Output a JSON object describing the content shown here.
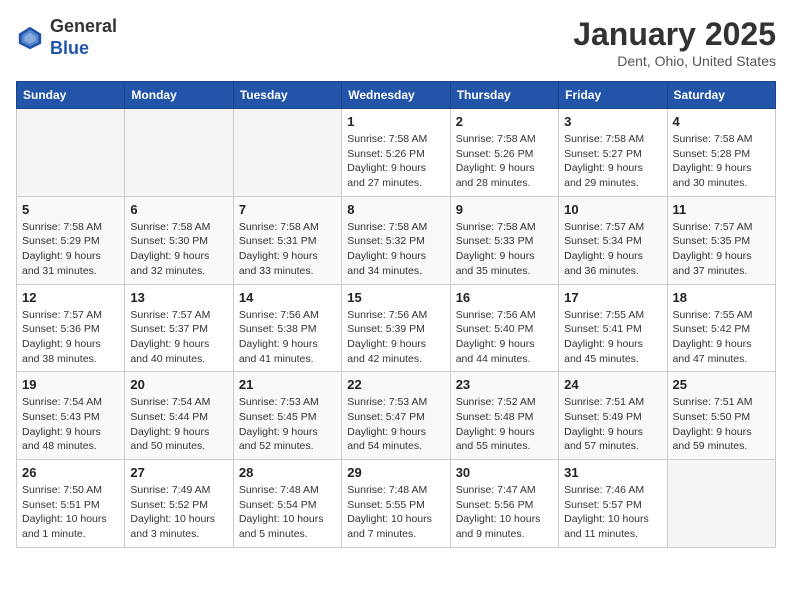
{
  "header": {
    "logo_line1": "General",
    "logo_line2": "Blue",
    "month": "January 2025",
    "location": "Dent, Ohio, United States"
  },
  "days_of_week": [
    "Sunday",
    "Monday",
    "Tuesday",
    "Wednesday",
    "Thursday",
    "Friday",
    "Saturday"
  ],
  "weeks": [
    [
      {
        "day": "",
        "info": ""
      },
      {
        "day": "",
        "info": ""
      },
      {
        "day": "",
        "info": ""
      },
      {
        "day": "1",
        "info": "Sunrise: 7:58 AM\nSunset: 5:26 PM\nDaylight: 9 hours and 27 minutes."
      },
      {
        "day": "2",
        "info": "Sunrise: 7:58 AM\nSunset: 5:26 PM\nDaylight: 9 hours and 28 minutes."
      },
      {
        "day": "3",
        "info": "Sunrise: 7:58 AM\nSunset: 5:27 PM\nDaylight: 9 hours and 29 minutes."
      },
      {
        "day": "4",
        "info": "Sunrise: 7:58 AM\nSunset: 5:28 PM\nDaylight: 9 hours and 30 minutes."
      }
    ],
    [
      {
        "day": "5",
        "info": "Sunrise: 7:58 AM\nSunset: 5:29 PM\nDaylight: 9 hours and 31 minutes."
      },
      {
        "day": "6",
        "info": "Sunrise: 7:58 AM\nSunset: 5:30 PM\nDaylight: 9 hours and 32 minutes."
      },
      {
        "day": "7",
        "info": "Sunrise: 7:58 AM\nSunset: 5:31 PM\nDaylight: 9 hours and 33 minutes."
      },
      {
        "day": "8",
        "info": "Sunrise: 7:58 AM\nSunset: 5:32 PM\nDaylight: 9 hours and 34 minutes."
      },
      {
        "day": "9",
        "info": "Sunrise: 7:58 AM\nSunset: 5:33 PM\nDaylight: 9 hours and 35 minutes."
      },
      {
        "day": "10",
        "info": "Sunrise: 7:57 AM\nSunset: 5:34 PM\nDaylight: 9 hours and 36 minutes."
      },
      {
        "day": "11",
        "info": "Sunrise: 7:57 AM\nSunset: 5:35 PM\nDaylight: 9 hours and 37 minutes."
      }
    ],
    [
      {
        "day": "12",
        "info": "Sunrise: 7:57 AM\nSunset: 5:36 PM\nDaylight: 9 hours and 38 minutes."
      },
      {
        "day": "13",
        "info": "Sunrise: 7:57 AM\nSunset: 5:37 PM\nDaylight: 9 hours and 40 minutes."
      },
      {
        "day": "14",
        "info": "Sunrise: 7:56 AM\nSunset: 5:38 PM\nDaylight: 9 hours and 41 minutes."
      },
      {
        "day": "15",
        "info": "Sunrise: 7:56 AM\nSunset: 5:39 PM\nDaylight: 9 hours and 42 minutes."
      },
      {
        "day": "16",
        "info": "Sunrise: 7:56 AM\nSunset: 5:40 PM\nDaylight: 9 hours and 44 minutes."
      },
      {
        "day": "17",
        "info": "Sunrise: 7:55 AM\nSunset: 5:41 PM\nDaylight: 9 hours and 45 minutes."
      },
      {
        "day": "18",
        "info": "Sunrise: 7:55 AM\nSunset: 5:42 PM\nDaylight: 9 hours and 47 minutes."
      }
    ],
    [
      {
        "day": "19",
        "info": "Sunrise: 7:54 AM\nSunset: 5:43 PM\nDaylight: 9 hours and 48 minutes."
      },
      {
        "day": "20",
        "info": "Sunrise: 7:54 AM\nSunset: 5:44 PM\nDaylight: 9 hours and 50 minutes."
      },
      {
        "day": "21",
        "info": "Sunrise: 7:53 AM\nSunset: 5:45 PM\nDaylight: 9 hours and 52 minutes."
      },
      {
        "day": "22",
        "info": "Sunrise: 7:53 AM\nSunset: 5:47 PM\nDaylight: 9 hours and 54 minutes."
      },
      {
        "day": "23",
        "info": "Sunrise: 7:52 AM\nSunset: 5:48 PM\nDaylight: 9 hours and 55 minutes."
      },
      {
        "day": "24",
        "info": "Sunrise: 7:51 AM\nSunset: 5:49 PM\nDaylight: 9 hours and 57 minutes."
      },
      {
        "day": "25",
        "info": "Sunrise: 7:51 AM\nSunset: 5:50 PM\nDaylight: 9 hours and 59 minutes."
      }
    ],
    [
      {
        "day": "26",
        "info": "Sunrise: 7:50 AM\nSunset: 5:51 PM\nDaylight: 10 hours and 1 minute."
      },
      {
        "day": "27",
        "info": "Sunrise: 7:49 AM\nSunset: 5:52 PM\nDaylight: 10 hours and 3 minutes."
      },
      {
        "day": "28",
        "info": "Sunrise: 7:48 AM\nSunset: 5:54 PM\nDaylight: 10 hours and 5 minutes."
      },
      {
        "day": "29",
        "info": "Sunrise: 7:48 AM\nSunset: 5:55 PM\nDaylight: 10 hours and 7 minutes."
      },
      {
        "day": "30",
        "info": "Sunrise: 7:47 AM\nSunset: 5:56 PM\nDaylight: 10 hours and 9 minutes."
      },
      {
        "day": "31",
        "info": "Sunrise: 7:46 AM\nSunset: 5:57 PM\nDaylight: 10 hours and 11 minutes."
      },
      {
        "day": "",
        "info": ""
      }
    ]
  ]
}
